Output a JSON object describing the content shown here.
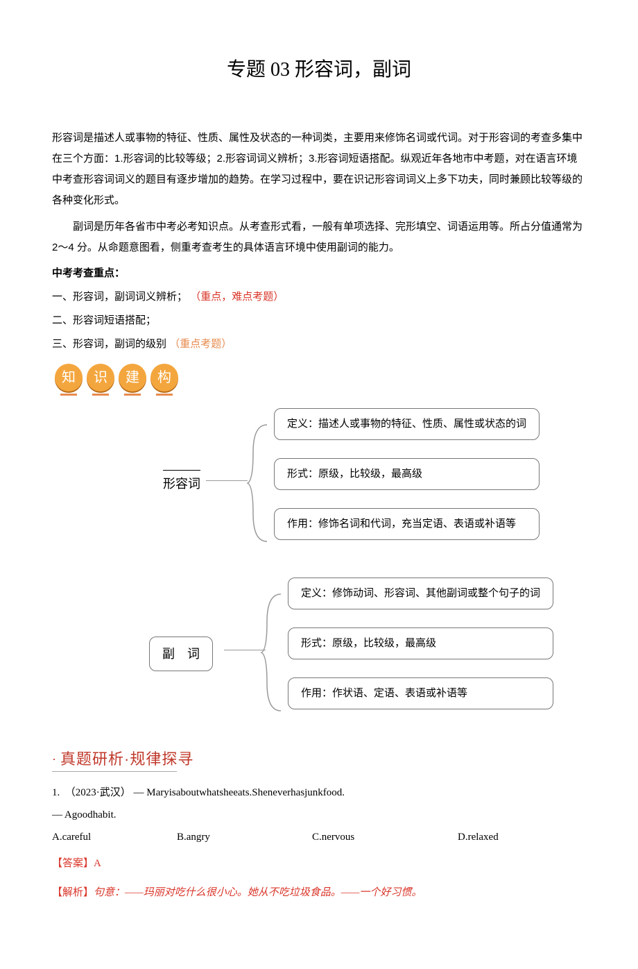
{
  "title": "专题 03 形容词，副词",
  "intro": {
    "p1": "形容词是描述人或事物的特征、性质、属性及状态的一种词类，主要用来修饰名词或代词。对于形容词的考查多集中在三个方面：1.形容词的比较等级；2.形容词词义辨析；3.形容词短语搭配。纵观近年各地市中考题，对在语言环境中考查形容词词义的题目有逐步增加的趋势。在学习过程中，要在识记形容词词义上多下功夫，同时兼顾比较等级的各种变化形式。",
    "p2": "副词是历年各省市中考必考知识点。从考查形式看，一般有单项选择、完形填空、词语运用等。所占分值通常为 2～4 分。从命题意图看，侧重考查考生的具体语言环境中使用副词的能力。"
  },
  "focus": {
    "heading": "中考考查重点：",
    "items": [
      {
        "prefix": "一、形容词，副词词义辨析；",
        "note": "（重点，难点考题）",
        "noteClass": "red"
      },
      {
        "prefix": "二、形容词短语搭配；",
        "note": "",
        "noteClass": ""
      },
      {
        "prefix": "三、形容词，副词的级别",
        "note": "（重点考题）",
        "noteClass": "red-light"
      }
    ]
  },
  "badges": [
    "知",
    "识",
    "建",
    "构"
  ],
  "maps": [
    {
      "label": "形容词",
      "overline": true,
      "items": [
        "定义：描述人或事物的特征、性质、属性或状态的词",
        "形式：原级，比较级，最高级",
        "作用：修饰名词和代词，充当定语、表语或补语等"
      ]
    },
    {
      "label": "副　词",
      "overline": false,
      "items": [
        "定义：修饰动词、形容词、其他副词或整个句子的词",
        "形式：原级，比较级，最高级",
        "作用：作状语、定语、表语或补语等"
      ]
    }
  ],
  "section_title": "真题研析·规律探寻",
  "question": {
    "number": "1.",
    "source": "（2023·武汉）",
    "stem_a": "— Maryisaboutwhatsheeats.Sheneverhasjunkfood.",
    "stem_b": "— Agoodhabit.",
    "options": {
      "A": "A.careful",
      "B": "B.angry",
      "C": "C.nervous",
      "D": "D.relaxed"
    },
    "answer_label": "【答案】",
    "answer_value": "A",
    "explain_label": "【解析】",
    "explain_text": "句意：——玛丽对吃什么很小心。她从不吃垃圾食品。——一个好习惯。"
  }
}
